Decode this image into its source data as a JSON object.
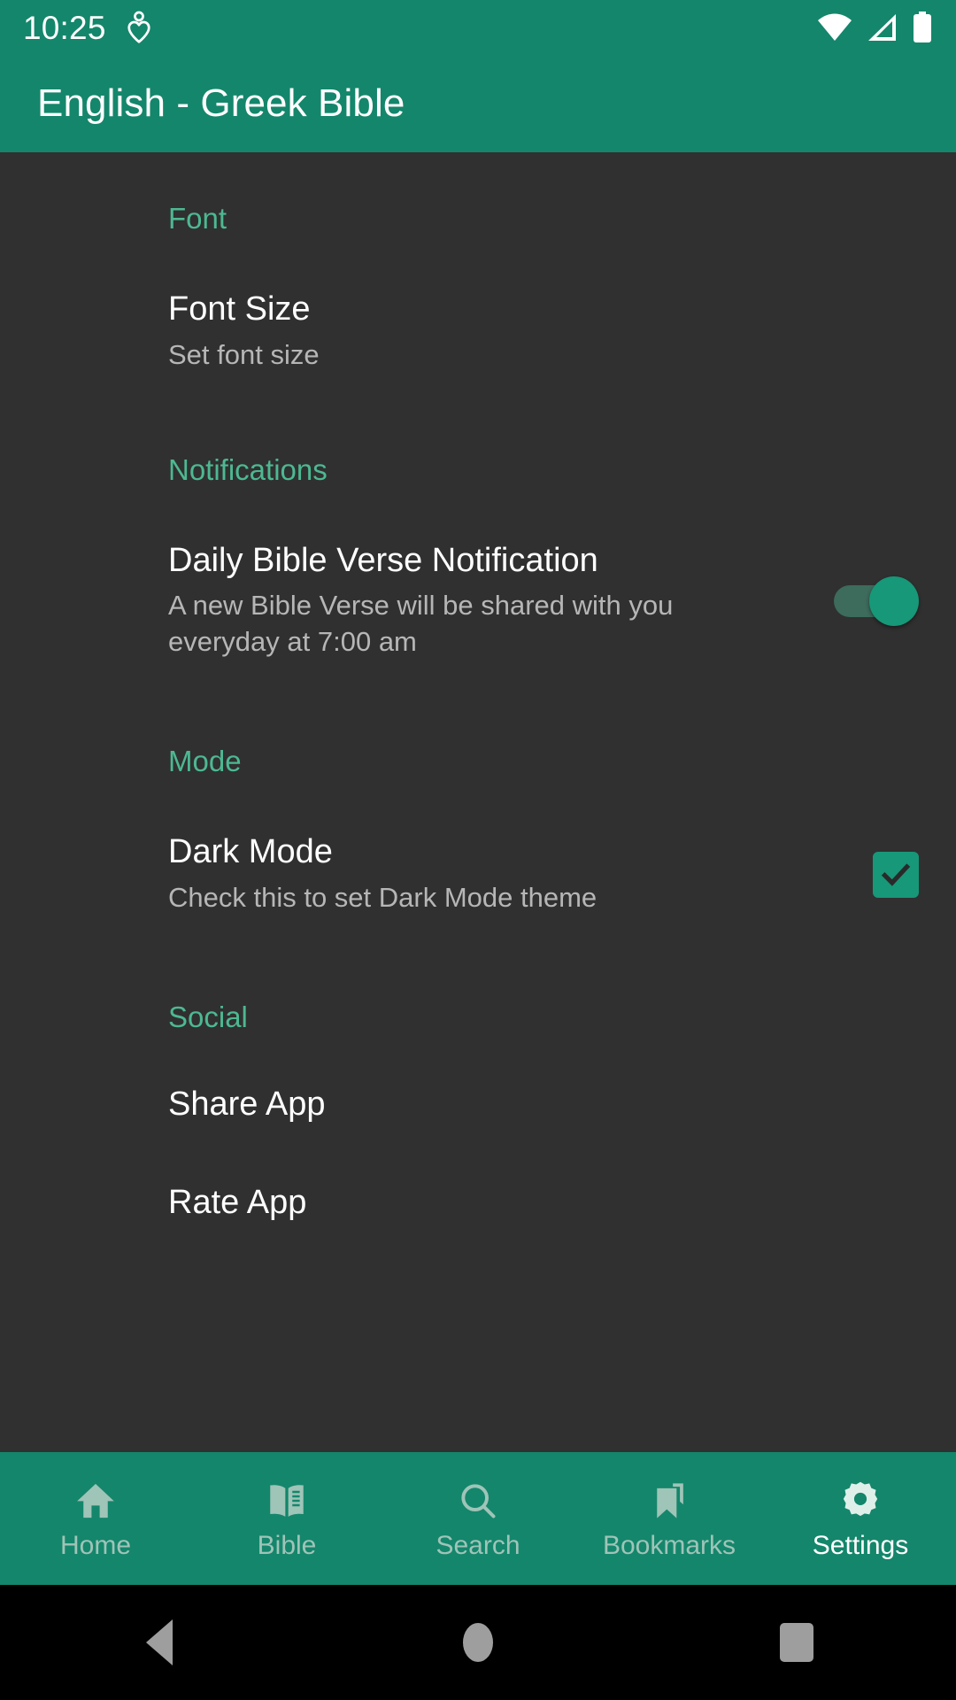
{
  "status_bar": {
    "time": "10:25",
    "icons": [
      "heart-health-icon",
      "wifi-icon",
      "signal-icon",
      "battery-icon"
    ]
  },
  "app_bar": {
    "title": "English - Greek Bible"
  },
  "theme": {
    "primary": "#14866B",
    "accent": "#4DB892",
    "switch_on": "#179878",
    "background": "#303030",
    "title_text": "#FFFFFF",
    "summary_text": "#B6B6B6",
    "nav_inactive": "#9FC4B8",
    "nav_active": "#FFFFFF"
  },
  "settings": {
    "sections": [
      {
        "header": "Font",
        "items": [
          {
            "title": "Font Size",
            "summary": "Set font size",
            "widget": "none"
          }
        ]
      },
      {
        "header": "Notifications",
        "items": [
          {
            "title": "Daily Bible Verse Notification",
            "summary": "A new Bible Verse will be shared with you everyday at 7:00 am",
            "widget": "switch",
            "widget_state": "on"
          }
        ]
      },
      {
        "header": "Mode",
        "items": [
          {
            "title": "Dark Mode",
            "summary": "Check this to set Dark Mode theme",
            "widget": "checkbox",
            "widget_state": "checked"
          }
        ]
      },
      {
        "header": "Social",
        "items": [
          {
            "title": "Share App",
            "summary": "",
            "widget": "none"
          },
          {
            "title": "Rate App",
            "summary": "",
            "widget": "none"
          }
        ]
      }
    ]
  },
  "bottom_nav": {
    "items": [
      {
        "label": "Home",
        "icon": "home-icon",
        "active": false
      },
      {
        "label": "Bible",
        "icon": "book-icon",
        "active": false
      },
      {
        "label": "Search",
        "icon": "search-icon",
        "active": false
      },
      {
        "label": "Bookmarks",
        "icon": "bookmark-icon",
        "active": false
      },
      {
        "label": "Settings",
        "icon": "gear-icon",
        "active": true
      }
    ]
  },
  "system_nav": {
    "buttons": [
      "back-button",
      "home-button",
      "recents-button"
    ]
  }
}
